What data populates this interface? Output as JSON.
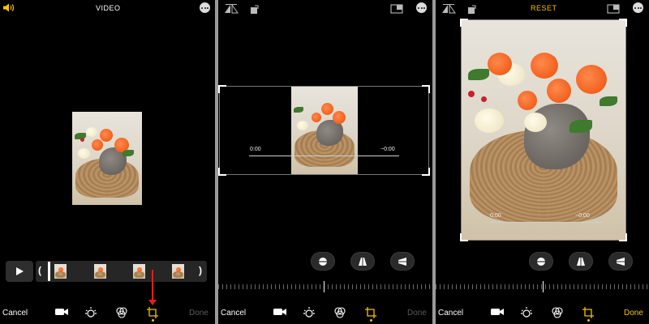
{
  "colors": {
    "accent": "#f7c200",
    "annotation_arrow": "#e0201d",
    "disabled_text": "#5a5a5a"
  },
  "panel1": {
    "title": "VIDEO",
    "icons": [
      "speaker-icon",
      "more-icon"
    ],
    "timeline": {
      "play_icon": "play-icon"
    },
    "toolbar": {
      "cancel": "Cancel",
      "done": "Done",
      "selected_tool": "crop",
      "tools": [
        "video-camera-icon",
        "adjust-dial-icon",
        "filters-icon",
        "crop-rotate-icon"
      ]
    }
  },
  "panel2": {
    "icons": [
      "flip-icon",
      "rotate-icon",
      "aspect-ratio-icon",
      "more-icon"
    ],
    "video": {
      "time_start": "0:00",
      "time_end": "−0:00"
    },
    "aspect_buttons": [
      "straighten-icon",
      "vertical-perspective-icon",
      "horizontal-perspective-icon"
    ],
    "toolbar": {
      "cancel": "Cancel",
      "done": "Done",
      "selected_tool": "crop"
    }
  },
  "panel3": {
    "reset": "RESET",
    "icons": [
      "flip-icon",
      "rotate-icon",
      "aspect-ratio-icon",
      "more-icon"
    ],
    "video": {
      "time_start": "0:00",
      "time_end": "−0:00"
    },
    "aspect_buttons": [
      "straighten-icon",
      "vertical-perspective-icon",
      "horizontal-perspective-icon"
    ],
    "toolbar": {
      "cancel": "Cancel",
      "done": "Done",
      "selected_tool": "crop"
    }
  }
}
